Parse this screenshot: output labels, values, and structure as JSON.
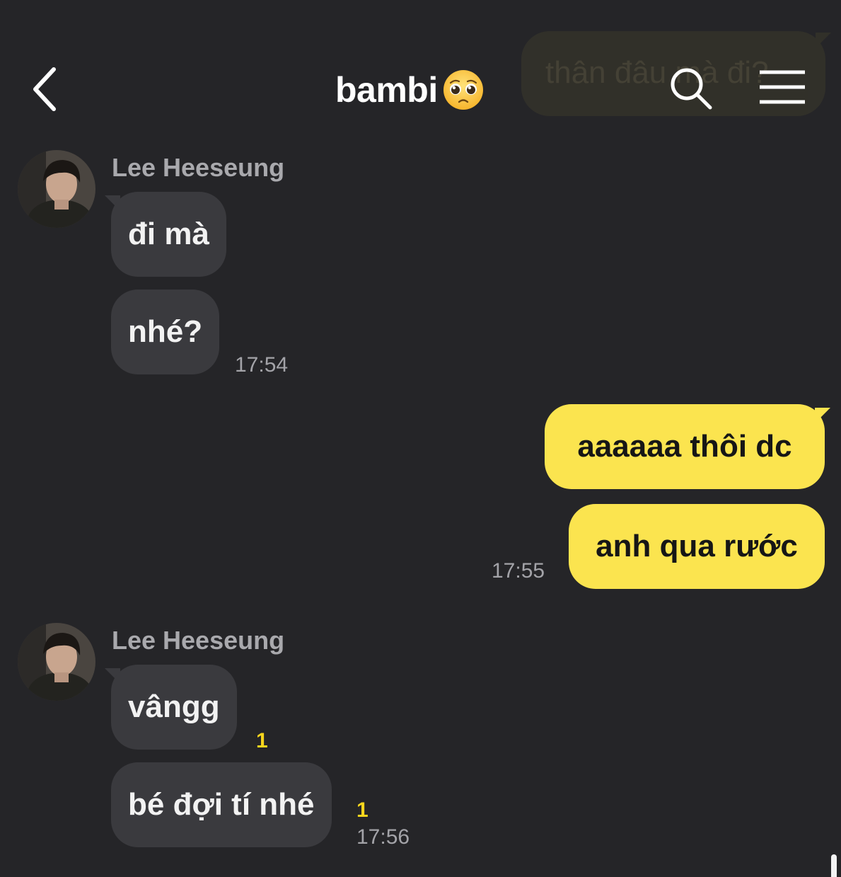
{
  "header": {
    "title": "bambi",
    "title_emoji": "pleading-face-icon",
    "back_icon": "chevron-left-icon",
    "search_icon": "search-icon",
    "menu_icon": "menu-icon"
  },
  "ghost_bubble": {
    "text": "thân đâu mà đi?"
  },
  "colors": {
    "background": "#252528",
    "incoming_bubble": "#3a3a3e",
    "outgoing_bubble": "#fbe44f",
    "unread_count": "#f7d51d"
  },
  "groups": [
    {
      "sender": "Lee Heeseung",
      "direction": "incoming",
      "messages": [
        {
          "text": "đi mà"
        },
        {
          "text": "nhé?"
        }
      ],
      "time": "17:54"
    },
    {
      "sender": "me",
      "direction": "outgoing",
      "messages": [
        {
          "text": "aaaaaa thôi dc"
        },
        {
          "text": "anh qua rước"
        }
      ],
      "time": "17:55"
    },
    {
      "sender": "Lee Heeseung",
      "direction": "incoming",
      "messages": [
        {
          "text": "vângg",
          "unread": "1"
        },
        {
          "text": "bé đợi tí nhé",
          "unread": "1"
        }
      ],
      "time": "17:56"
    }
  ]
}
